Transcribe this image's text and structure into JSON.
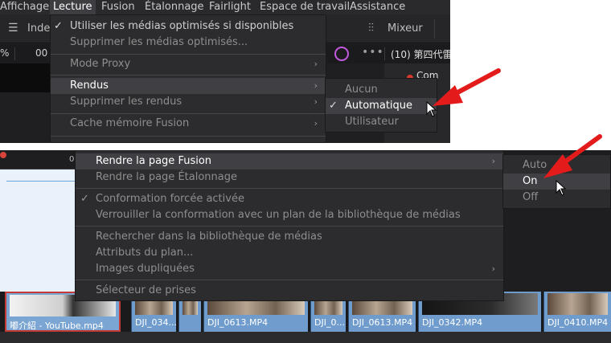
{
  "menubar": {
    "items": [
      "Affichage",
      "Lecture",
      "Fusion",
      "Étalonnage",
      "Fairlight",
      "Espace de travail",
      "Assistance"
    ]
  },
  "toolbar": {
    "index_label": "Inde",
    "mixer_label": "Mixeur"
  },
  "row2": {
    "zoom_prefix": "%",
    "timecode_prefix": "00",
    "clip_title": "(10) 第四代雷"
  },
  "right_panel": {
    "text": "Com"
  },
  "lecture_menu": {
    "items": [
      {
        "label": "Utiliser les médias optimisés si disponibles",
        "checked": true,
        "submenu": false,
        "dim": false
      },
      {
        "label": "Supprimer les médias optimisés...",
        "checked": false,
        "submenu": false,
        "dim": true
      },
      {
        "label": "Mode Proxy",
        "checked": false,
        "submenu": true,
        "dim": true
      },
      {
        "label": "Rendus",
        "checked": false,
        "submenu": true,
        "dim": false,
        "highlighted": true
      },
      {
        "label": "Supprimer les rendus",
        "checked": false,
        "submenu": true,
        "dim": true
      },
      {
        "label": "Cache mémoire Fusion",
        "checked": false,
        "submenu": true,
        "dim": true
      }
    ]
  },
  "rendus_submenu": {
    "items": [
      {
        "label": "Aucun",
        "checked": false,
        "dim": true
      },
      {
        "label": "Automatique",
        "checked": true,
        "dim": false,
        "highlighted": true
      },
      {
        "label": "Utilisateur",
        "checked": false,
        "dim": true
      }
    ]
  },
  "clip_menu": {
    "items": [
      {
        "label": "Rendre la page Fusion",
        "checked": false,
        "submenu": true,
        "dim": false,
        "highlighted": true
      },
      {
        "label": "Rendre la page Étalonnage",
        "checked": false,
        "submenu": false,
        "dim": true
      },
      {
        "label": "Conformation forcée activée",
        "checked": true,
        "submenu": false,
        "dim": true
      },
      {
        "label": "Verrouiller la conformation avec un plan de la bibliothèque de médias",
        "checked": false,
        "submenu": false,
        "dim": true
      },
      {
        "label": "Rechercher dans la bibliothèque de médias",
        "checked": false,
        "submenu": false,
        "dim": true
      },
      {
        "label": "Attributs du plan...",
        "checked": false,
        "submenu": false,
        "dim": true
      },
      {
        "label": "Images dupliquées",
        "checked": false,
        "submenu": true,
        "dim": true
      },
      {
        "label": "Sélecteur de prises",
        "checked": false,
        "submenu": false,
        "dim": true
      }
    ]
  },
  "fusion_submenu": {
    "items": [
      {
        "label": "Auto",
        "dim": true
      },
      {
        "label": "On",
        "dim": false,
        "highlighted": true
      },
      {
        "label": "Off",
        "dim": true
      }
    ]
  },
  "timeline": {
    "ruler_marker": "0",
    "clips": [
      {
        "name": "嘟介紹 - YouTube.mp4",
        "selected": true,
        "thumb": "white"
      },
      {
        "name": "DJI_034...",
        "selected": false,
        "thumb": "photo"
      },
      {
        "name": "",
        "selected": false,
        "thumb": "photo"
      },
      {
        "name": "DJI_0613.MP4",
        "selected": false,
        "thumb": "photo"
      },
      {
        "name": "DJI_0...",
        "selected": false,
        "thumb": "photo"
      },
      {
        "name": "DJI_0613.MP4",
        "selected": false,
        "thumb": "photo"
      },
      {
        "name": "DJI_0342.MP4",
        "selected": false,
        "thumb": "dark"
      },
      {
        "name": "DJI_0410.MP4",
        "selected": false,
        "thumb": "photo"
      }
    ]
  },
  "colors": {
    "menu_bg": "#2c2c2f",
    "highlight": "#3f3f44",
    "annotation_arrow": "#e31b1b",
    "clip_blue": "#6f9ccd"
  },
  "icons": [
    "check-icon",
    "submenu-arrow-icon",
    "mouse-cursor-icon",
    "red-annotation-arrow",
    "index-icon",
    "mixer-icon",
    "fx-icon"
  ]
}
